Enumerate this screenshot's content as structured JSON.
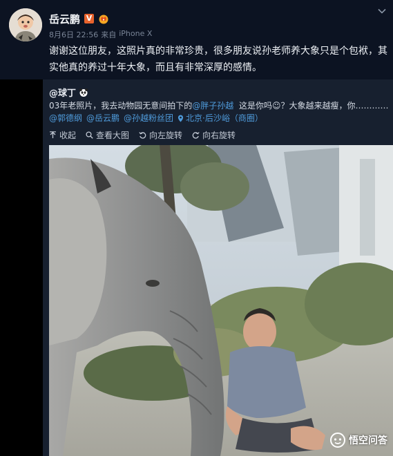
{
  "post": {
    "author": "岳云鹏",
    "verified_badge": "V",
    "date": "8月6日 22:56",
    "source_prefix": "来自",
    "source": "iPhone X",
    "text": "谢谢这位朋友，这照片真的非常珍贵，很多朋友说孙老师养大象只是个包袱，其实他真的养过十年大象，而且有非常深厚的感情。"
  },
  "repost": {
    "user": "@球丁",
    "text_prefix": "03年老照片，我去动物园无意间拍下的",
    "text_mention": "@胖子孙越",
    "text_suffix": "这是你吗☺？大象越来越瘦，你…………",
    "tags": [
      "@郭德纲",
      "@岳云鹏",
      "@孙越粉丝团"
    ],
    "location": "北京·后沙峪（商圈）"
  },
  "toolbar": {
    "collapse": "收起",
    "view_large": "查看大图",
    "rotate_left": "向左旋转",
    "rotate_right": "向右旋转"
  },
  "watermark": {
    "text": "悟空问答"
  },
  "colors": {
    "top_bg": "#0c1322",
    "repost_bg": "#17202f",
    "link": "#4f9bdb",
    "badge": "#e8632d"
  },
  "icons": [
    "chevron-down-icon",
    "crown-icon",
    "panda-icon",
    "location-icon",
    "collapse-icon",
    "magnify-icon",
    "rotate-left-icon",
    "rotate-right-icon",
    "wukong-logo-icon"
  ]
}
